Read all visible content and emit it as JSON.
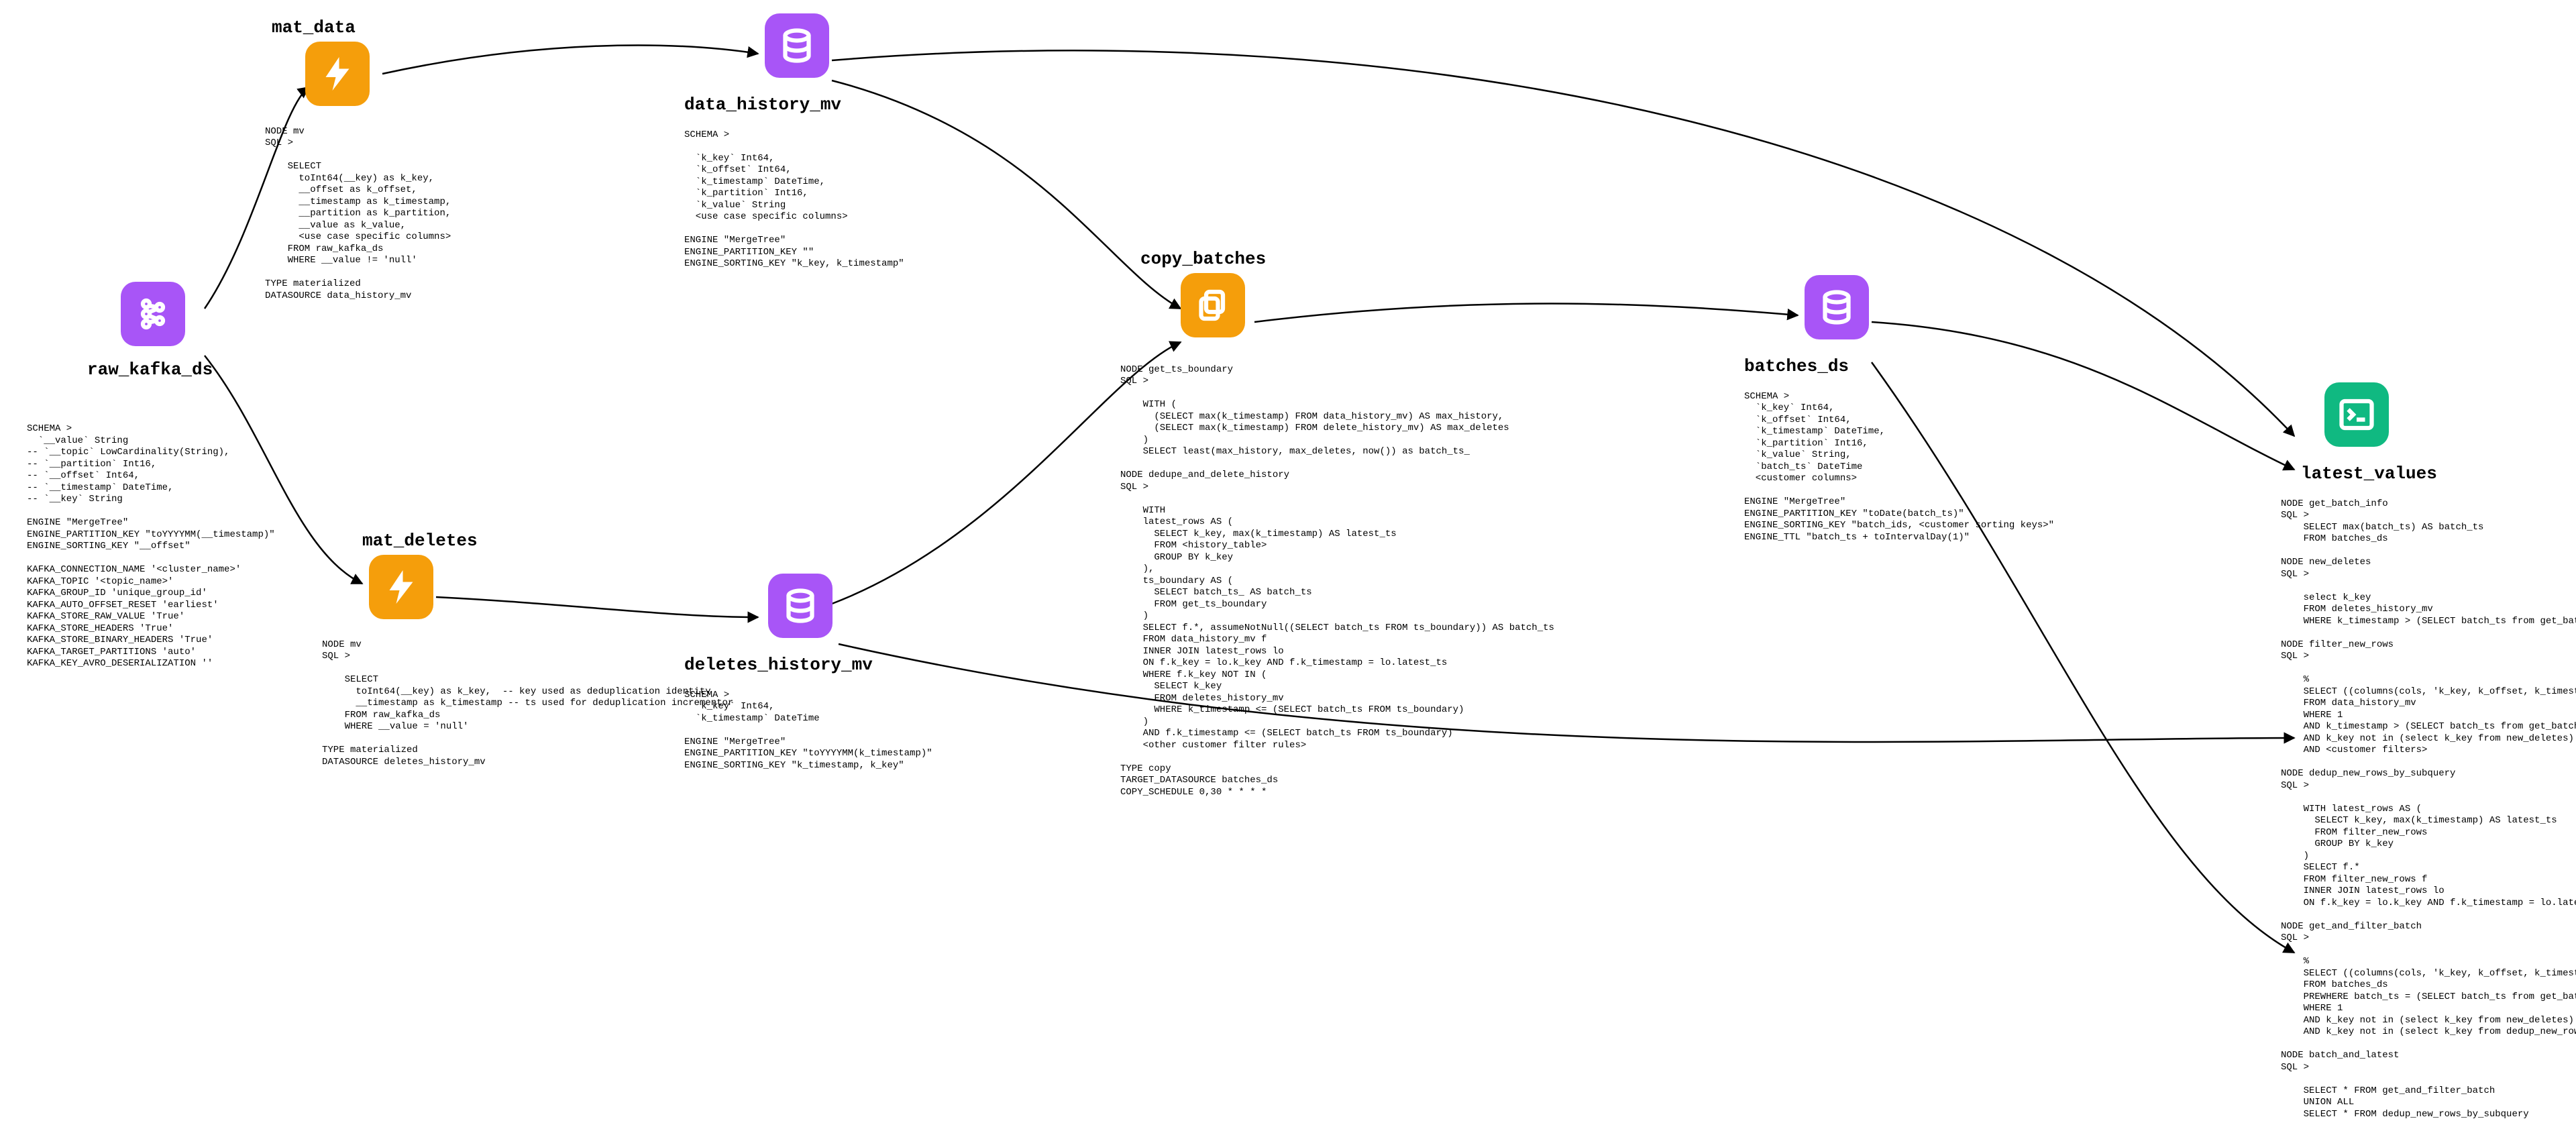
{
  "nodes": {
    "raw_kafka_ds": {
      "title": "raw_kafka_ds",
      "details": "SCHEMA >\n  `__value` String\n-- `__topic` LowCardinality(String),\n-- `__partition` Int16,\n-- `__offset` Int64,\n-- `__timestamp` DateTime,\n-- `__key` String\n\nENGINE \"MergeTree\"\nENGINE_PARTITION_KEY \"toYYYYMM(__timestamp)\"\nENGINE_SORTING_KEY \"__offset\"\n\nKAFKA_CONNECTION_NAME '<cluster_name>'\nKAFKA_TOPIC '<topic_name>'\nKAFKA_GROUP_ID 'unique_group_id'\nKAFKA_AUTO_OFFSET_RESET 'earliest'\nKAFKA_STORE_RAW_VALUE 'True'\nKAFKA_STORE_HEADERS 'True'\nKAFKA_STORE_BINARY_HEADERS 'True'\nKAFKA_TARGET_PARTITIONS 'auto'\nKAFKA_KEY_AVRO_DESERIALIZATION ''"
    },
    "mat_data": {
      "title": "mat_data",
      "details": "NODE mv\nSQL >\n\n    SELECT\n      toInt64(__key) as k_key,\n      __offset as k_offset,\n      __timestamp as k_timestamp,\n      __partition as k_partition,\n      __value as k_value,\n      <use case specific columns>\n    FROM raw_kafka_ds\n    WHERE __value != 'null'\n\nTYPE materialized\nDATASOURCE data_history_mv"
    },
    "mat_deletes": {
      "title": "mat_deletes",
      "details": "NODE mv\nSQL >\n\n    SELECT\n      toInt64(__key) as k_key,  -- key used as deduplication identity\n      __timestamp as k_timestamp -- ts used for deduplication incrementor\n    FROM raw_kafka_ds\n    WHERE __value = 'null'\n\nTYPE materialized\nDATASOURCE deletes_history_mv"
    },
    "data_history_mv": {
      "title": "data_history_mv",
      "details": "SCHEMA >\n\n  `k_key` Int64,\n  `k_offset` Int64,\n  `k_timestamp` DateTime,\n  `k_partition` Int16,\n  `k_value` String\n  <use case specific columns>\n\nENGINE \"MergeTree\"\nENGINE_PARTITION_KEY \"\"\nENGINE_SORTING_KEY \"k_key, k_timestamp\""
    },
    "deletes_history_mv": {
      "title": "deletes_history_mv",
      "details": "SCHEMA >\n  `k_key` Int64,\n  `k_timestamp` DateTime\n\nENGINE \"MergeTree\"\nENGINE_PARTITION_KEY \"toYYYYMM(k_timestamp)\"\nENGINE_SORTING_KEY \"k_timestamp, k_key\""
    },
    "copy_batches": {
      "title": "copy_batches",
      "details": "NODE get_ts_boundary\nSQL >\n\n    WITH (\n      (SELECT max(k_timestamp) FROM data_history_mv) AS max_history,\n      (SELECT max(k_timestamp) FROM delete_history_mv) AS max_deletes\n    )\n    SELECT least(max_history, max_deletes, now()) as batch_ts_\n\nNODE dedupe_and_delete_history\nSQL >\n\n    WITH\n    latest_rows AS (\n      SELECT k_key, max(k_timestamp) AS latest_ts\n      FROM <history_table>\n      GROUP BY k_key\n    ),\n    ts_boundary AS (\n      SELECT batch_ts_ AS batch_ts\n      FROM get_ts_boundary\n    )\n    SELECT f.*, assumeNotNull((SELECT batch_ts FROM ts_boundary)) AS batch_ts\n    FROM data_history_mv f\n    INNER JOIN latest_rows lo\n    ON f.k_key = lo.k_key AND f.k_timestamp = lo.latest_ts\n    WHERE f.k_key NOT IN (\n      SELECT k_key\n      FROM deletes_history_mv\n      WHERE k_timestamp <= (SELECT batch_ts FROM ts_boundary)\n    )\n    AND f.k_timestamp <= (SELECT batch_ts FROM ts_boundary)\n    <other customer filter rules>\n\nTYPE copy\nTARGET_DATASOURCE batches_ds\nCOPY_SCHEDULE 0,30 * * * *"
    },
    "batches_ds": {
      "title": "batches_ds",
      "details": "SCHEMA >\n  `k_key` Int64,\n  `k_offset` Int64,\n  `k_timestamp` DateTime,\n  `k_partition` Int16,\n  `k_value` String,\n  `batch_ts` DateTime\n  <customer columns>\n\nENGINE \"MergeTree\"\nENGINE_PARTITION_KEY \"toDate(batch_ts)\"\nENGINE_SORTING_KEY \"batch_ids, <customer sorting keys>\"\nENGINE_TTL \"batch_ts + toIntervalDay(1)\""
    },
    "latest_values": {
      "title": "latest_values",
      "details": "NODE get_batch_info\nSQL >\n    SELECT max(batch_ts) AS batch_ts\n    FROM batches_ds\n\nNODE new_deletes\nSQL >\n\n    select k_key\n    FROM deletes_history_mv\n    WHERE k_timestamp > (SELECT batch_ts from get_batch_info) -- only rows since last batch\n\nNODE filter_new_rows\nSQL >\n\n    %\n    SELECT ((columns(cols, 'k_key, k_offset, k_timestamp, <customer_cols>)))\n    FROM data_history_mv\n    WHERE 1\n    AND k_timestamp > (SELECT batch_ts from get_batch_info) -- only rows since last batch\n    AND k_key not in (select k_key from new_deletes)  -- remove newly deleted rows from new rows\n    AND <customer filters>\n\nNODE dedup_new_rows_by_subquery\nSQL >\n\n    WITH latest_rows AS (\n      SELECT k_key, max(k_timestamp) AS latest_ts\n      FROM filter_new_rows\n      GROUP BY k_key\n    )\n    SELECT f.*\n    FROM filter_new_rows f\n    INNER JOIN latest_rows lo\n    ON f.k_key = lo.k_key AND f.k_timestamp = lo.latest_ts\n\nNODE get_and_filter_batch\nSQL >\n\n    %\n    SELECT ((columns(cols, 'k_key, k_offset, k_timestamp, <customer_cols>)))\n    FROM batches_ds\n    PREWHERE batch_ts = (SELECT batch_ts from get_batch_info) -- get latest batch\n    WHERE 1\n    AND k_key not in (select k_key from new_deletes)  -- filter by new deletes since last batch\n    AND k_key not in (select k_key from dedup_new_rows_by_subquery)  -- omit rows already updated since batch\n\nNODE batch_and_latest\nSQL >\n\n    SELECT * FROM get_and_filter_batch\n    UNION ALL\n    SELECT * FROM dedup_new_rows_by_subquery"
    }
  }
}
